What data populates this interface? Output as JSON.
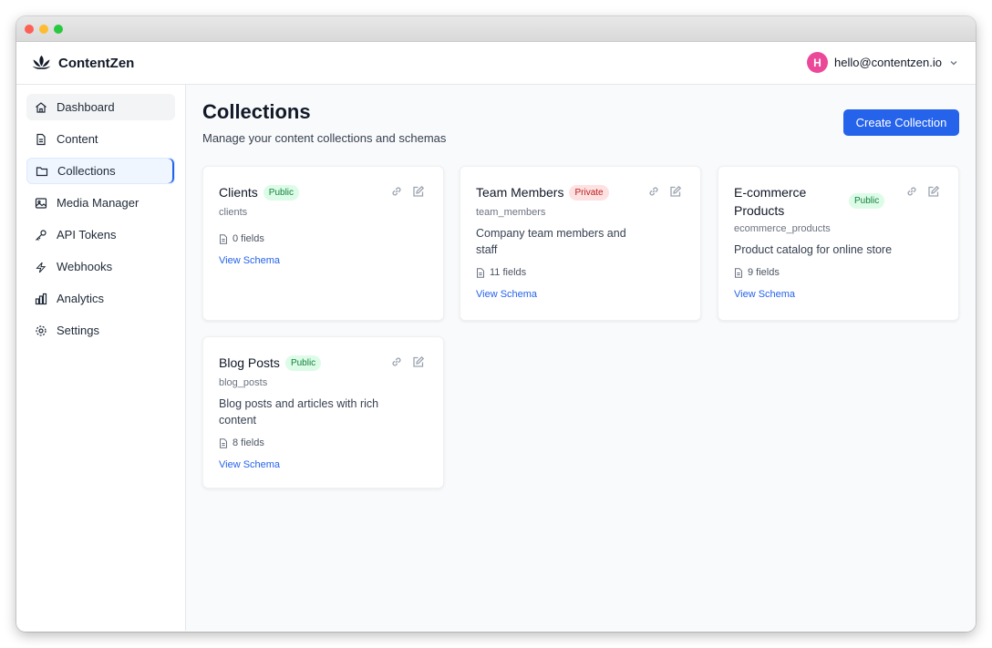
{
  "app": {
    "brand_name": "ContentZen",
    "account_initial": "H",
    "account_email": "hello@contentzen.io"
  },
  "sidebar": {
    "items": [
      {
        "label": "Dashboard",
        "icon": "home-icon"
      },
      {
        "label": "Content",
        "icon": "document-icon"
      },
      {
        "label": "Collections",
        "icon": "folder-icon"
      },
      {
        "label": "Media Manager",
        "icon": "image-icon"
      },
      {
        "label": "API Tokens",
        "icon": "key-icon"
      },
      {
        "label": "Webhooks",
        "icon": "lightning-icon"
      },
      {
        "label": "Analytics",
        "icon": "bar-chart-icon"
      },
      {
        "label": "Settings",
        "icon": "gear-icon"
      }
    ],
    "active": "Collections",
    "hover": "Dashboard"
  },
  "main": {
    "title": "Collections",
    "subtitle": "Manage your content collections and schemas",
    "create_button": "Create Collection",
    "view_schema_label": "View Schema",
    "collections": [
      {
        "name": "Clients",
        "visibility": "Public",
        "slug": "clients",
        "description": "",
        "fields": "0 fields"
      },
      {
        "name": "Team Members",
        "visibility": "Private",
        "slug": "team_members",
        "description": "Company team members and staff",
        "fields": "11 fields"
      },
      {
        "name": "E-commerce Products",
        "visibility": "Public",
        "slug": "ecommerce_products",
        "description": "Product catalog for online store",
        "fields": "9 fields"
      },
      {
        "name": "Blog Posts",
        "visibility": "Public",
        "slug": "blog_posts",
        "description": "Blog posts and articles with rich content",
        "fields": "8 fields"
      }
    ]
  },
  "colors": {
    "accent": "#2563eb",
    "avatar": "#ec4899",
    "public_badge_bg": "#dcfce7",
    "public_badge_text": "#15803d",
    "private_badge_bg": "#fee2e2",
    "private_badge_text": "#b91c1c"
  }
}
